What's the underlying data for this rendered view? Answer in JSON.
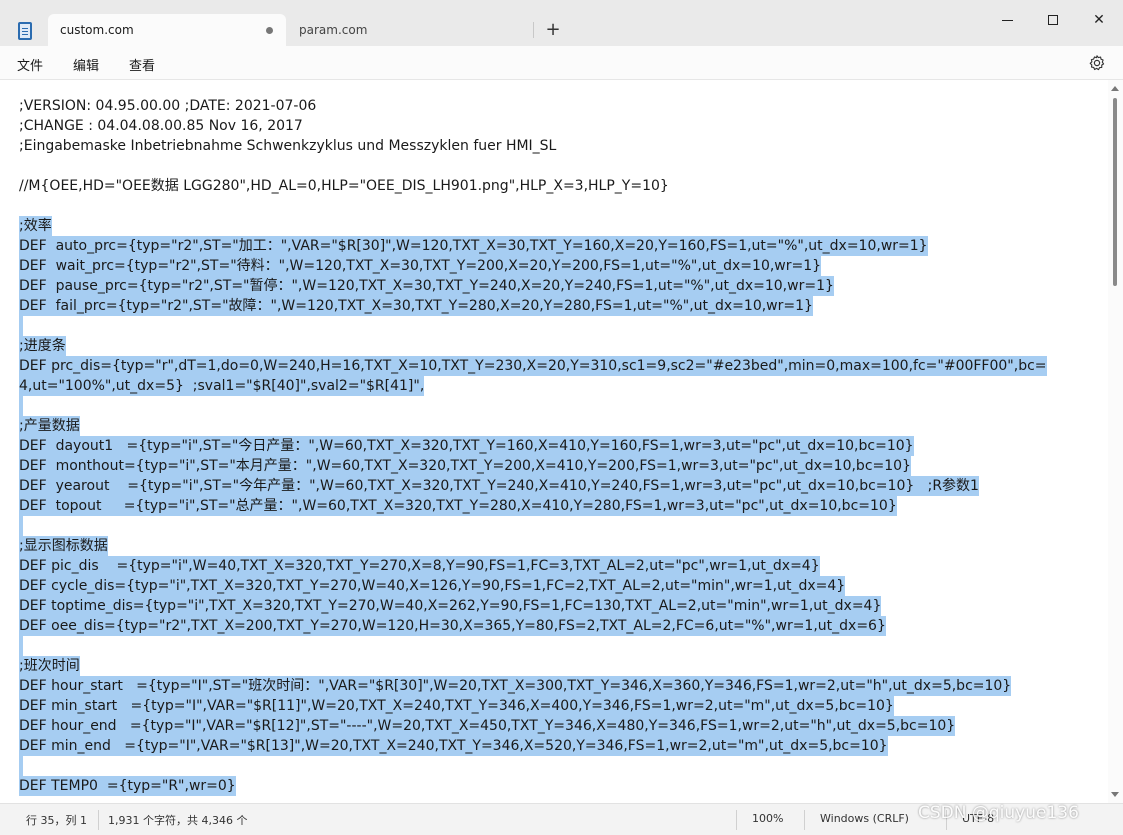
{
  "window": {
    "tabs": [
      {
        "label": "custom.com",
        "active": true
      },
      {
        "label": "param.com",
        "active": false
      }
    ],
    "new_tab_glyph": "+",
    "close_glyph": "✕"
  },
  "menu": {
    "items": [
      "文件",
      "编辑",
      "查看"
    ]
  },
  "icons": {
    "app": "notepad-icon",
    "settings": "gear-icon",
    "close": "close-icon"
  },
  "editor": {
    "selection_color": "#a6cdf2",
    "lines": [
      {
        "text": ";VERSION: 04.95.00.00 ;DATE: 2021-07-06",
        "selected": false
      },
      {
        "text": ";CHANGE : 04.04.08.00.85 Nov 16, 2017",
        "selected": false
      },
      {
        "text": ";Eingabemaske Inbetriebnahme Schwenkzyklus und Messzyklen fuer HMI_SL",
        "selected": false
      },
      {
        "text": "",
        "selected": false
      },
      {
        "text": "//M{OEE,HD=\"OEE数据 LGG280\",HD_AL=0,HLP=\"OEE_DIS_LH901.png\",HLP_X=3,HLP_Y=10}",
        "selected": false
      },
      {
        "text": "",
        "selected": false
      },
      {
        "text": ";效率",
        "selected": true
      },
      {
        "text": "DEF  auto_prc={typ=\"r2\",ST=\"加工：\",VAR=\"$R[30]\",W=120,TXT_X=30,TXT_Y=160,X=20,Y=160,FS=1,ut=\"%\",ut_dx=10,wr=1}",
        "selected": true
      },
      {
        "text": "DEF  wait_prc={typ=\"r2\",ST=\"待料：\",W=120,TXT_X=30,TXT_Y=200,X=20,Y=200,FS=1,ut=\"%\",ut_dx=10,wr=1}",
        "selected": true
      },
      {
        "text": "DEF  pause_prc={typ=\"r2\",ST=\"暂停：\",W=120,TXT_X=30,TXT_Y=240,X=20,Y=240,FS=1,ut=\"%\",ut_dx=10,wr=1}",
        "selected": true
      },
      {
        "text": "DEF  fail_prc={typ=\"r2\",ST=\"故障：\",W=120,TXT_X=30,TXT_Y=280,X=20,Y=280,FS=1,ut=\"%\",ut_dx=10,wr=1}",
        "selected": true
      },
      {
        "text": " ",
        "selected": true
      },
      {
        "text": ";进度条",
        "selected": true
      },
      {
        "text": "DEF prc_dis={typ=\"r\",dT=1,do=0,W=240,H=16,TXT_X=10,TXT_Y=230,X=20,Y=310,sc1=9,sc2=\"#e23bed\",min=0,max=100,fc=\"#00FF00\",bc=",
        "selected": true
      },
      {
        "text": "4,ut=\"100%\",ut_dx=5}  ;sval1=\"$R[40]\",sval2=\"$R[41]\",",
        "selected": true
      },
      {
        "text": " ",
        "selected": true
      },
      {
        "text": ";产量数据",
        "selected": true
      },
      {
        "text": "DEF  dayout1   ={typ=\"i\",ST=\"今日产量：\",W=60,TXT_X=320,TXT_Y=160,X=410,Y=160,FS=1,wr=3,ut=\"pc\",ut_dx=10,bc=10}",
        "selected": true
      },
      {
        "text": "DEF  monthout={typ=\"i\",ST=\"本月产量：\",W=60,TXT_X=320,TXT_Y=200,X=410,Y=200,FS=1,wr=3,ut=\"pc\",ut_dx=10,bc=10}",
        "selected": true
      },
      {
        "text": "DEF  yearout    ={typ=\"i\",ST=\"今年产量：\",W=60,TXT_X=320,TXT_Y=240,X=410,Y=240,FS=1,wr=3,ut=\"pc\",ut_dx=10,bc=10}   ;R参数1",
        "selected": true
      },
      {
        "text": "DEF  topout     ={typ=\"i\",ST=\"总产量：\",W=60,TXT_X=320,TXT_Y=280,X=410,Y=280,FS=1,wr=3,ut=\"pc\",ut_dx=10,bc=10}",
        "selected": true
      },
      {
        "text": " ",
        "selected": true
      },
      {
        "text": ";显示图标数据",
        "selected": true
      },
      {
        "text": "DEF pic_dis    ={typ=\"i\",W=40,TXT_X=320,TXT_Y=270,X=8,Y=90,FS=1,FC=3,TXT_AL=2,ut=\"pc\",wr=1,ut_dx=4}",
        "selected": true
      },
      {
        "text": "DEF cycle_dis={typ=\"i\",TXT_X=320,TXT_Y=270,W=40,X=126,Y=90,FS=1,FC=2,TXT_AL=2,ut=\"min\",wr=1,ut_dx=4}",
        "selected": true
      },
      {
        "text": "DEF toptime_dis={typ=\"i\",TXT_X=320,TXT_Y=270,W=40,X=262,Y=90,FS=1,FC=130,TXT_AL=2,ut=\"min\",wr=1,ut_dx=4}",
        "selected": true
      },
      {
        "text": "DEF oee_dis={typ=\"r2\",TXT_X=200,TXT_Y=270,W=120,H=30,X=365,Y=80,FS=2,TXT_AL=2,FC=6,ut=\"%\",wr=1,ut_dx=6}",
        "selected": true
      },
      {
        "text": " ",
        "selected": true
      },
      {
        "text": ";班次时间",
        "selected": true
      },
      {
        "text": "DEF hour_start   ={typ=\"I\",ST=\"班次时间：\",VAR=\"$R[30]\",W=20,TXT_X=300,TXT_Y=346,X=360,Y=346,FS=1,wr=2,ut=\"h\",ut_dx=5,bc=10}",
        "selected": true
      },
      {
        "text": "DEF min_start   ={typ=\"I\",VAR=\"$R[11]\",W=20,TXT_X=240,TXT_Y=346,X=400,Y=346,FS=1,wr=2,ut=\"m\",ut_dx=5,bc=10}",
        "selected": true
      },
      {
        "text": "DEF hour_end   ={typ=\"I\",VAR=\"$R[12]\",ST=\"----\",W=20,TXT_X=450,TXT_Y=346,X=480,Y=346,FS=1,wr=2,ut=\"h\",ut_dx=5,bc=10}",
        "selected": true
      },
      {
        "text": "DEF min_end   ={typ=\"I\",VAR=\"$R[13]\",W=20,TXT_X=240,TXT_Y=346,X=520,Y=346,FS=1,wr=2,ut=\"m\",ut_dx=5,bc=10}",
        "selected": true
      },
      {
        "text": " ",
        "selected": true
      },
      {
        "text": "DEF TEMP0  ={typ=\"R\",wr=0}",
        "selected": true
      }
    ]
  },
  "status": {
    "position": "行 35，列 1",
    "counts": "1,931 个字符，共 4,346 个",
    "zoom": "100%",
    "line_ending": "Windows (CRLF)",
    "encoding": "UTF-8"
  },
  "watermark": "CSDN @qiuyue136"
}
